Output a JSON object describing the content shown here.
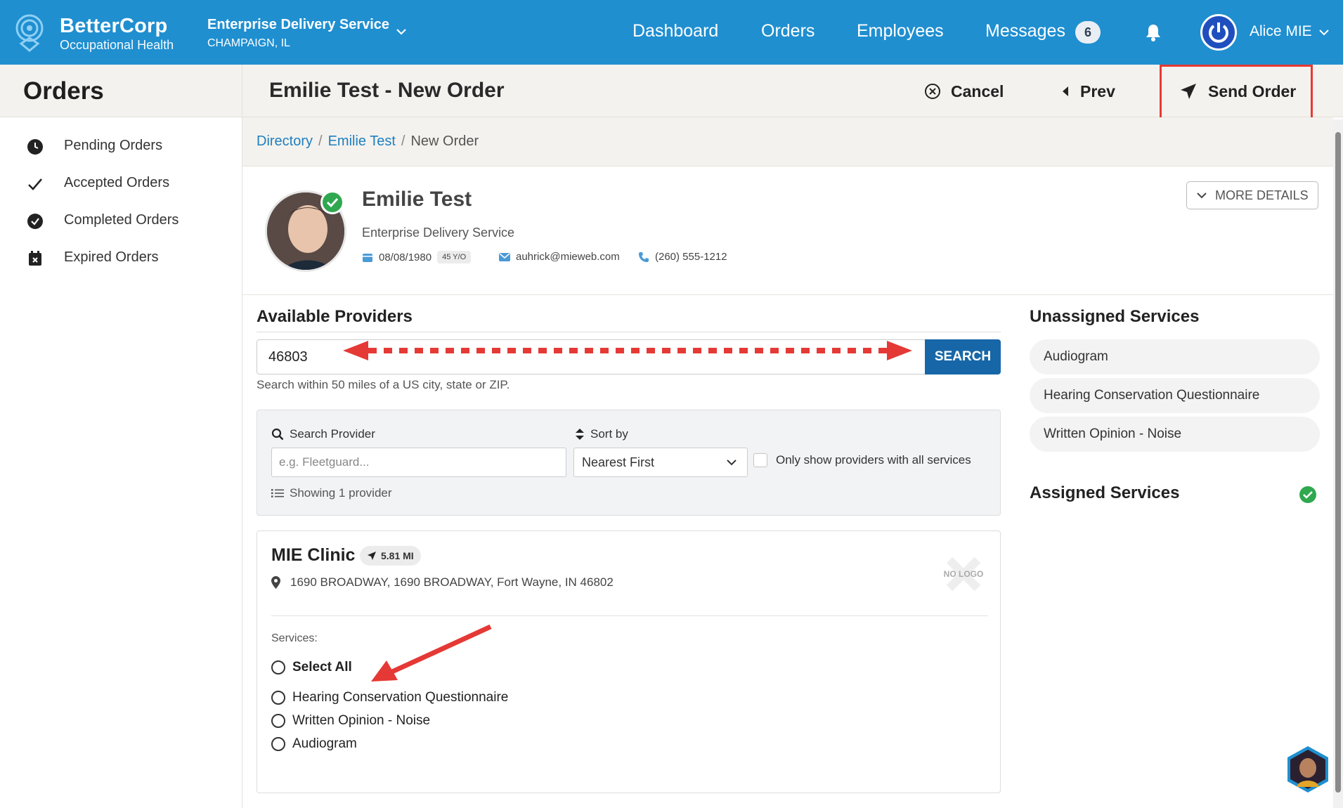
{
  "header": {
    "brand_name": "BetterCorp",
    "brand_sub": "Occupational Health",
    "company_name": "Enterprise Delivery Service",
    "company_location": "CHAMPAIGN, IL",
    "nav": [
      "Dashboard",
      "Orders",
      "Employees",
      "Messages"
    ],
    "messages_count": "6",
    "user_name": "Alice MIE",
    "accent": "#1f8fd0"
  },
  "sidebar": {
    "title": "Orders",
    "items": [
      {
        "label": "Pending Orders",
        "icon": "clock-icon"
      },
      {
        "label": "Accepted Orders",
        "icon": "checkmark-icon"
      },
      {
        "label": "Completed Orders",
        "icon": "check-circle-icon"
      },
      {
        "label": "Expired Orders",
        "icon": "calendar-x-icon"
      }
    ]
  },
  "order": {
    "title": "Emilie Test - New Order",
    "cancel_label": "Cancel",
    "prev_label": "Prev",
    "send_label": "Send Order"
  },
  "breadcrumb": {
    "items": [
      "Directory",
      "Emilie Test",
      "New Order"
    ]
  },
  "patient": {
    "name": "Emilie Test",
    "company": "Enterprise Delivery Service",
    "dob": "08/08/1980",
    "age": "45 Y/O",
    "email": "auhrick@mieweb.com",
    "phone": "(260) 555-1212",
    "more_details_label": "MORE DETAILS"
  },
  "providers": {
    "title": "Available Providers",
    "zip_value": "46803",
    "search_label": "SEARCH",
    "zip_hint": "Search within 50 miles of a US city, state or ZIP.",
    "search_provider_label": "Search Provider",
    "search_provider_placeholder": "e.g. Fleetguard...",
    "sort_label": "Sort by",
    "sort_value": "Nearest First",
    "only_all_services_label": "Only show providers with all services",
    "showing_count": "Showing 1 provider",
    "clinic": {
      "name": "MIE Clinic",
      "distance": "5.81 MI",
      "address": "1690 BROADWAY, 1690 BROADWAY, Fort Wayne, IN 46802",
      "logo_text": "NO LOGO",
      "services_label": "Services:",
      "select_all_label": "Select All",
      "services": [
        "Hearing Conservation Questionnaire",
        "Written Opinion - Noise",
        "Audiogram"
      ]
    }
  },
  "right": {
    "unassigned_title": "Unassigned Services",
    "unassigned": [
      "Audiogram",
      "Hearing Conservation Questionnaire",
      "Written Opinion - Noise"
    ],
    "assigned_title": "Assigned Services"
  }
}
